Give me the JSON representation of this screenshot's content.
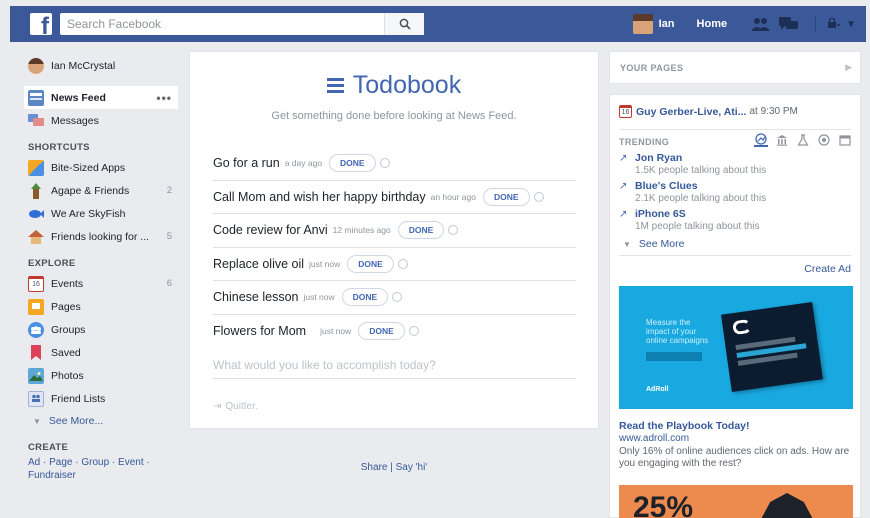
{
  "topbar": {
    "logo": "f",
    "search_placeholder": "Search Facebook",
    "user_name": "Ian",
    "home_label": "Home"
  },
  "leftnav": {
    "profile_name": "Ian McCrystal",
    "main_items": [
      {
        "label": "News Feed",
        "icon": "news-feed-icon"
      },
      {
        "label": "Messages",
        "icon": "messages-icon"
      }
    ],
    "shortcuts_heading": "SHORTCUTS",
    "shortcuts": [
      {
        "label": "Bite-Sized Apps",
        "count": ""
      },
      {
        "label": "Agape & Friends",
        "count": "2"
      },
      {
        "label": "We Are SkyFish",
        "count": ""
      },
      {
        "label": "Friends looking for ...",
        "count": "5"
      }
    ],
    "explore_heading": "EXPLORE",
    "explore": [
      {
        "label": "Events",
        "count": "6",
        "icon_text": "16"
      },
      {
        "label": "Pages",
        "count": ""
      },
      {
        "label": "Groups",
        "count": ""
      },
      {
        "label": "Saved",
        "count": ""
      },
      {
        "label": "Photos",
        "count": ""
      },
      {
        "label": "Friend Lists",
        "count": ""
      }
    ],
    "see_more": "See More...",
    "create_heading": "CREATE",
    "create_links": "Ad · Page · Group · Event · Fundraiser"
  },
  "todobook": {
    "title": "Todobook",
    "subtitle": "Get something done before looking at News Feed.",
    "done_label": "DONE",
    "tasks": [
      {
        "text": "Go for a run",
        "time": "a day ago"
      },
      {
        "text": "Call Mom and wish her happy birthday",
        "time": "an hour ago"
      },
      {
        "text": "Code review for Anvi",
        "time": "12 minutes ago"
      },
      {
        "text": "Replace olive oil",
        "time": "just now"
      },
      {
        "text": "Chinese lesson",
        "time": "just now"
      },
      {
        "text": "Flowers for Mom",
        "time": "just now"
      }
    ],
    "new_task_placeholder": "What would you like to accomplish today?",
    "quitter": "Quitter."
  },
  "footer": {
    "share": "Share | Say 'hi'"
  },
  "right": {
    "your_pages": "YOUR PAGES",
    "event_icon_text": "16",
    "event_name": "Guy Gerber-Live, Ati...",
    "event_time": "at 9:30 PM",
    "trending_heading": "TRENDING",
    "trends": [
      {
        "name": "Jon Ryan",
        "sub": "1.5K people talking about this"
      },
      {
        "name": "Blue's Clues",
        "sub": "2.1K people talking about this"
      },
      {
        "name": "iPhone 6S",
        "sub": "1M people talking about this"
      }
    ],
    "see_more": "See More",
    "create_ad": "Create Ad",
    "ad": {
      "image_text": "Measure the impact of your online campaigns",
      "brand": "AdRoll",
      "title": "Read the Playbook Today!",
      "url": "www.adroll.com",
      "description": "Only 16% of online audiences click on ads. How are you engaging with the rest?"
    },
    "ad2_text": "25%"
  },
  "colors": {
    "brand": "#3b5998",
    "accent": "#4267b2",
    "link": "#365899",
    "background": "#e9ebee"
  }
}
